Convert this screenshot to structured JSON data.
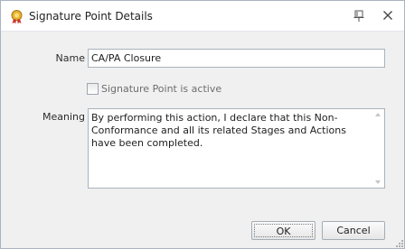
{
  "window": {
    "title": "Signature Point Details",
    "icons": {
      "app": "signature-seal-icon",
      "pin": "pin-icon",
      "close": "close-icon"
    }
  },
  "form": {
    "name_label": "Name",
    "name_value": "CA/PA Closure",
    "active_label": "Signature Point is active",
    "active_checked": false,
    "meaning_label": "Meaning",
    "meaning_value": "By performing this action, I declare that this Non-Conformance and all its related Stages and Actions have been completed."
  },
  "buttons": {
    "ok": "OK",
    "cancel": "Cancel"
  }
}
